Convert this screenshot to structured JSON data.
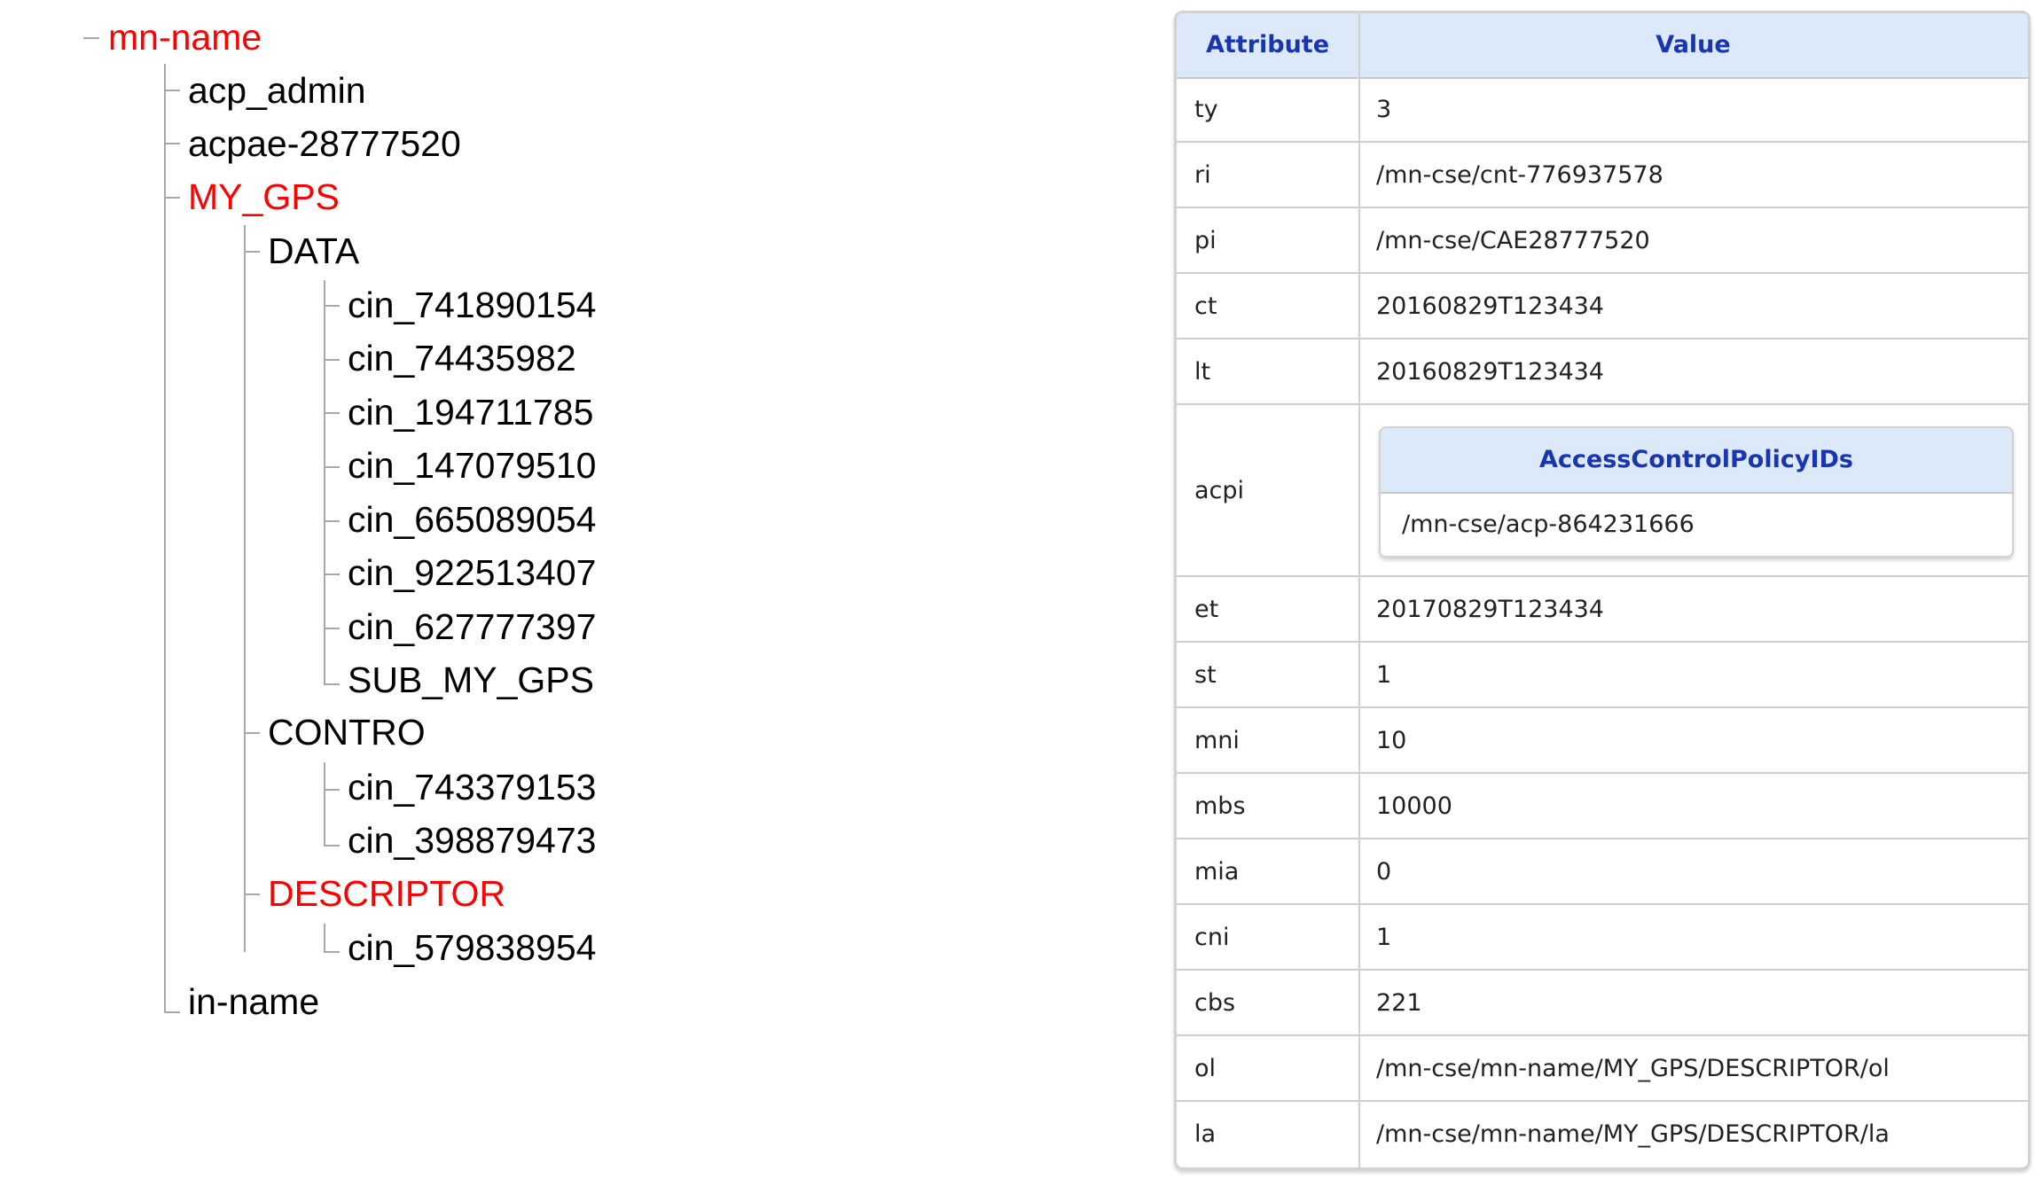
{
  "tree": {
    "root": "mn-name",
    "children": [
      "acp_admin",
      "acpae-28777520",
      "MY_GPS",
      "DATA",
      "cin_741890154",
      "cin_74435982",
      "cin_194711785",
      "cin_147079510",
      "cin_665089054",
      "cin_922513407",
      "cin_627777397",
      "SUB_MY_GPS",
      "CONTRO",
      "cin_743379153",
      "cin_398879473",
      "DESCRIPTOR",
      "cin_579838954",
      "in-name"
    ],
    "highlight_color": "#ff0000"
  },
  "table": {
    "headers": {
      "attribute": "Attribute",
      "value": "Value"
    },
    "rows": [
      {
        "attr": "ty",
        "value": "3"
      },
      {
        "attr": "ri",
        "value": "/mn-cse/cnt-776937578"
      },
      {
        "attr": "pi",
        "value": "/mn-cse/CAE28777520"
      },
      {
        "attr": "ct",
        "value": "20160829T123434"
      },
      {
        "attr": "lt",
        "value": "20160829T123434"
      },
      {
        "attr": "acpi",
        "nested_header": "AccessControlPolicyIDs",
        "nested_value": "/mn-cse/acp-864231666"
      },
      {
        "attr": "et",
        "value": "20170829T123434"
      },
      {
        "attr": "st",
        "value": "1"
      },
      {
        "attr": "mni",
        "value": "10"
      },
      {
        "attr": "mbs",
        "value": "10000"
      },
      {
        "attr": "mia",
        "value": "0"
      },
      {
        "attr": "cni",
        "value": "1"
      },
      {
        "attr": "cbs",
        "value": "221"
      },
      {
        "attr": "ol",
        "value": "/mn-cse/mn-name/MY_GPS/DESCRIPTOR/ol"
      },
      {
        "attr": "la",
        "value": "/mn-cse/mn-name/MY_GPS/DESCRIPTOR/la"
      }
    ],
    "header_bg": "#dce9f8",
    "header_text_color": "#1a35b0"
  }
}
